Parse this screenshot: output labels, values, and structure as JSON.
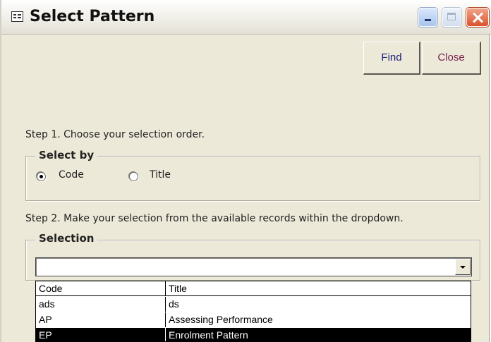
{
  "window": {
    "title": "Select Pattern"
  },
  "toolbar": {
    "find_label": "Find",
    "close_label": "Close"
  },
  "step1": {
    "text": "Step 1. Choose your selection order.",
    "group_label": "Select by",
    "options": [
      {
        "label": "Code",
        "checked": true
      },
      {
        "label": "Title",
        "checked": false
      }
    ]
  },
  "step2": {
    "text": "Step 2. Make your selection from the available records within the dropdown.",
    "group_label": "Selection",
    "combo_value": ""
  },
  "dropdown": {
    "columns": [
      "Code",
      "Title"
    ],
    "rows": [
      {
        "code": "ads",
        "title": "ds"
      },
      {
        "code": "AP",
        "title": "Assessing Performance"
      },
      {
        "code": "EP",
        "title": "Enrolment Pattern",
        "selected": true
      }
    ]
  }
}
